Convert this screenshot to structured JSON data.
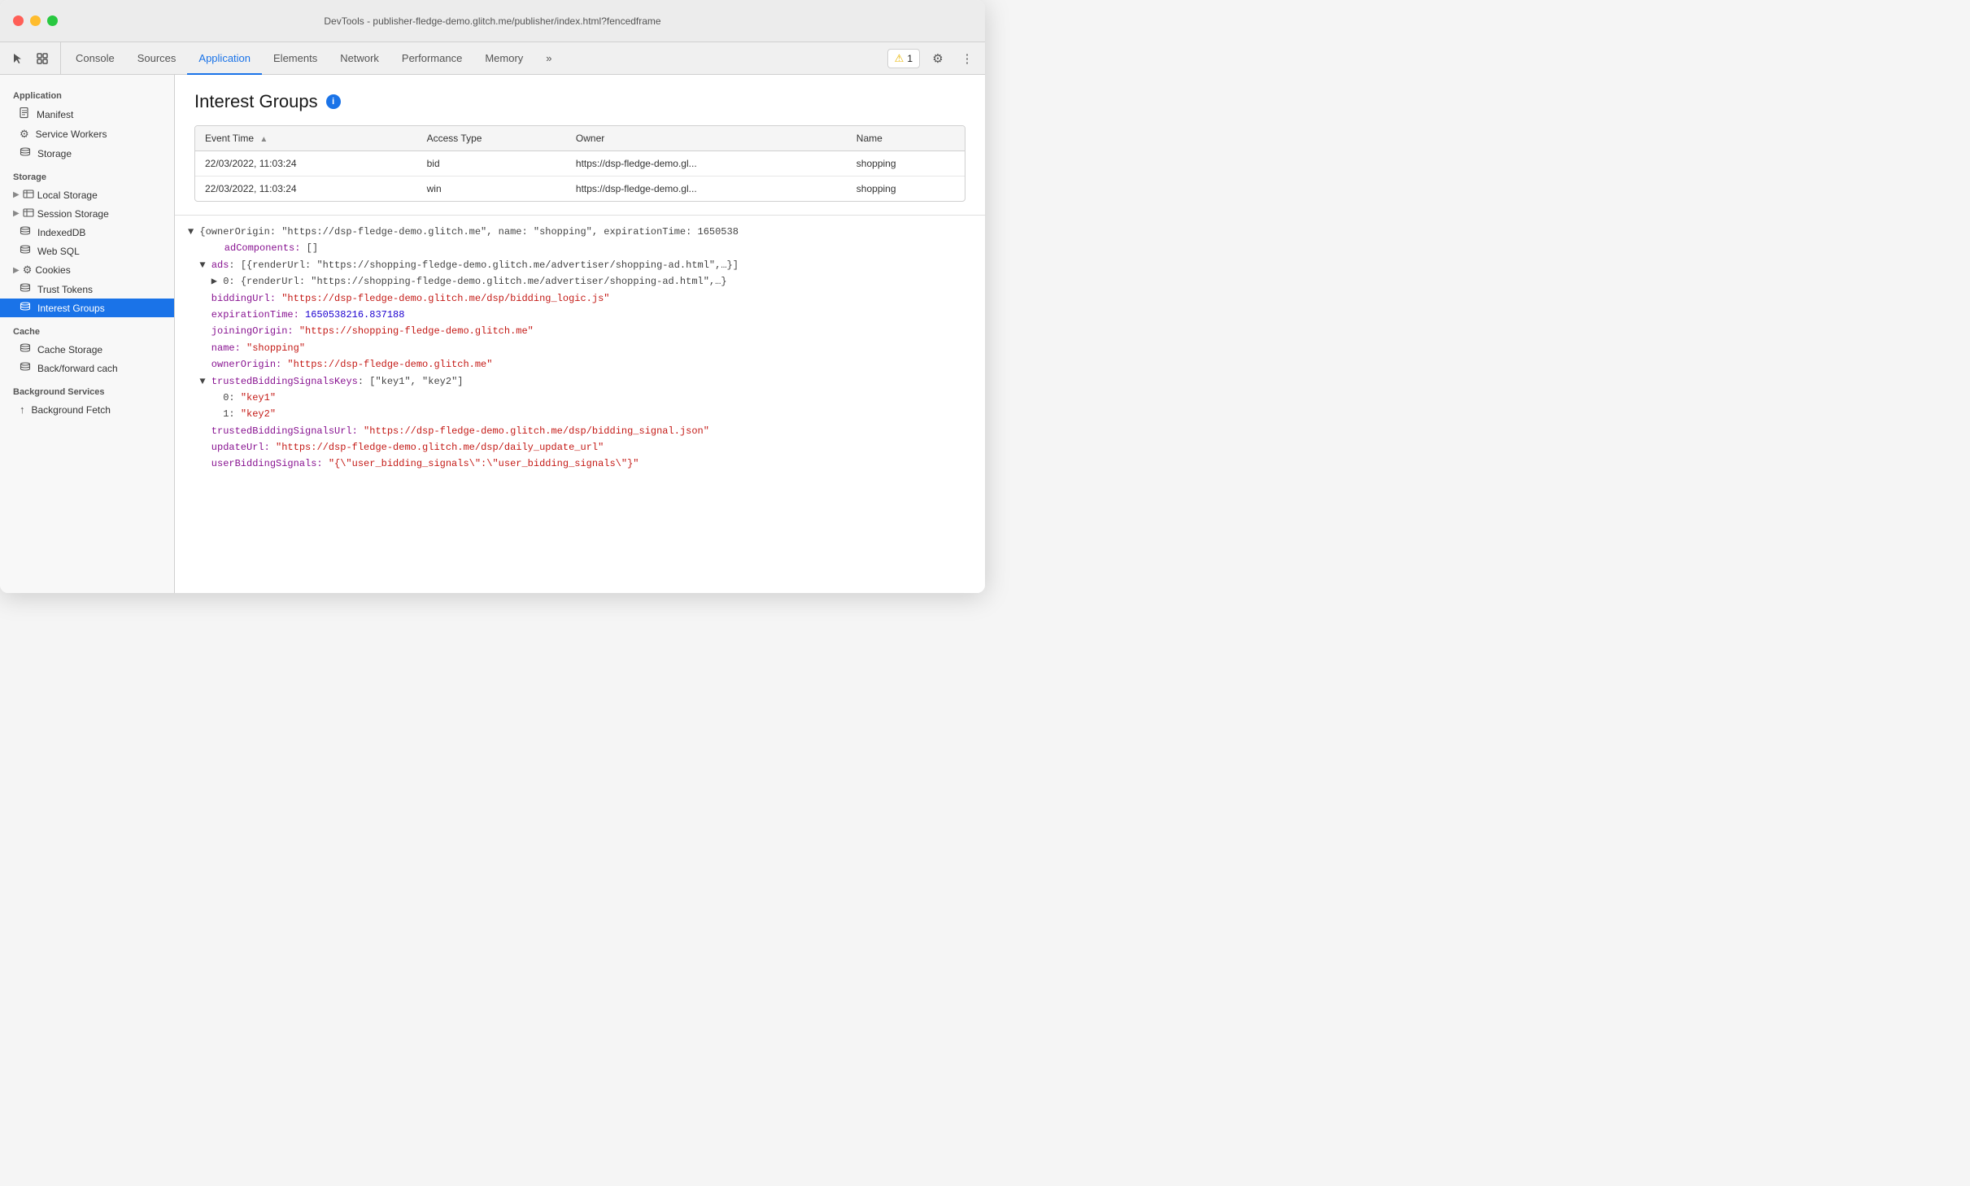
{
  "window": {
    "title": "DevTools - publisher-fledge-demo.glitch.me/publisher/index.html?fencedframe"
  },
  "toolbar": {
    "tabs": [
      {
        "id": "console",
        "label": "Console",
        "active": false
      },
      {
        "id": "sources",
        "label": "Sources",
        "active": false
      },
      {
        "id": "application",
        "label": "Application",
        "active": true
      },
      {
        "id": "elements",
        "label": "Elements",
        "active": false
      },
      {
        "id": "network",
        "label": "Network",
        "active": false
      },
      {
        "id": "performance",
        "label": "Performance",
        "active": false
      },
      {
        "id": "memory",
        "label": "Memory",
        "active": false
      }
    ],
    "more_label": "»",
    "warning_count": "1",
    "settings_icon": "⚙",
    "more_icon": "⋮"
  },
  "sidebar": {
    "sections": [
      {
        "id": "application",
        "label": "Application",
        "items": [
          {
            "id": "manifest",
            "label": "Manifest",
            "icon": "📄",
            "active": false
          },
          {
            "id": "service-workers",
            "label": "Service Workers",
            "icon": "⚙",
            "active": false
          },
          {
            "id": "storage",
            "label": "Storage",
            "icon": "🗄",
            "active": false
          }
        ]
      },
      {
        "id": "storage",
        "label": "Storage",
        "items": [
          {
            "id": "local-storage",
            "label": "Local Storage",
            "icon": "▶",
            "expandable": true,
            "active": false
          },
          {
            "id": "session-storage",
            "label": "Session Storage",
            "icon": "▶",
            "expandable": true,
            "active": false
          },
          {
            "id": "indexeddb",
            "label": "IndexedDB",
            "icon": "🗄",
            "active": false
          },
          {
            "id": "web-sql",
            "label": "Web SQL",
            "icon": "🗄",
            "active": false
          },
          {
            "id": "cookies",
            "label": "Cookies",
            "icon": "▶",
            "expandable": true,
            "active": false
          },
          {
            "id": "trust-tokens",
            "label": "Trust Tokens",
            "icon": "🗄",
            "active": false
          },
          {
            "id": "interest-groups",
            "label": "Interest Groups",
            "icon": "🗄",
            "active": true
          }
        ]
      },
      {
        "id": "cache",
        "label": "Cache",
        "items": [
          {
            "id": "cache-storage",
            "label": "Cache Storage",
            "icon": "🗄",
            "active": false
          },
          {
            "id": "back-forward-cache",
            "label": "Back/forward cach",
            "icon": "🗄",
            "active": false
          }
        ]
      },
      {
        "id": "background-services",
        "label": "Background Services",
        "items": [
          {
            "id": "background-fetch",
            "label": "Background Fetch",
            "icon": "↑",
            "active": false
          }
        ]
      }
    ]
  },
  "interest_groups": {
    "title": "Interest Groups",
    "table": {
      "columns": [
        {
          "id": "event_time",
          "label": "Event Time",
          "sortable": true
        },
        {
          "id": "access_type",
          "label": "Access Type"
        },
        {
          "id": "owner",
          "label": "Owner"
        },
        {
          "id": "name",
          "label": "Name"
        }
      ],
      "rows": [
        {
          "event_time": "22/03/2022, 11:03:24",
          "access_type": "bid",
          "owner": "https://dsp-fledge-demo.gl...",
          "name": "shopping"
        },
        {
          "event_time": "22/03/2022, 11:03:24",
          "access_type": "win",
          "owner": "https://dsp-fledge-demo.gl...",
          "name": "shopping"
        }
      ]
    },
    "detail": {
      "lines": [
        {
          "text": "▼ {ownerOrigin: \"https://dsp-fledge-demo.glitch.me\", name: \"shopping\", expirationTime: 1650538",
          "type": "root"
        },
        {
          "text": "    adComponents: []",
          "type": "indent1"
        },
        {
          "text": "  ▼ ads: [{renderUrl: \"https://shopping-fledge-demo.glitch.me/advertiser/shopping-ad.html\",…}]",
          "type": "indent1-expand"
        },
        {
          "text": "    ▶ 0: {renderUrl: \"https://shopping-fledge-demo.glitch.me/advertiser/shopping-ad.html\",…}",
          "type": "indent2-expand"
        },
        {
          "text": "    biddingUrl: \"https://dsp-fledge-demo.glitch.me/dsp/bidding_logic.js\"",
          "type": "indent1-kv-str",
          "key": "biddingUrl",
          "val": "\"https://dsp-fledge-demo.glitch.me/dsp/bidding_logic.js\""
        },
        {
          "text": "    expirationTime: 1650538216.837188",
          "type": "indent1-kv-num",
          "key": "expirationTime",
          "val": "1650538216.837188"
        },
        {
          "text": "    joiningOrigin: \"https://shopping-fledge-demo.glitch.me\"",
          "type": "indent1-kv-str",
          "key": "joiningOrigin",
          "val": "\"https://shopping-fledge-demo.glitch.me\""
        },
        {
          "text": "    name: \"shopping\"",
          "type": "indent1-kv-str",
          "key": "name",
          "val": "\"shopping\""
        },
        {
          "text": "    ownerOrigin: \"https://dsp-fledge-demo.glitch.me\"",
          "type": "indent1-kv-str",
          "key": "ownerOrigin",
          "val": "\"https://dsp-fledge-demo.glitch.me\""
        },
        {
          "text": "  ▼ trustedBiddingSignalsKeys: [\"key1\", \"key2\"]",
          "type": "indent1-expand"
        },
        {
          "text": "      0: \"key1\"",
          "type": "indent2-kv-str",
          "key": "0",
          "val": "\"key1\""
        },
        {
          "text": "      1: \"key2\"",
          "type": "indent2-kv-str",
          "key": "1",
          "val": "\"key2\""
        },
        {
          "text": "    trustedBiddingSignalsUrl: \"https://dsp-fledge-demo.glitch.me/dsp/bidding_signal.json\"",
          "type": "indent1-kv-str",
          "key": "trustedBiddingSignalsUrl",
          "val": "\"https://dsp-fledge-demo.glitch.me/dsp/bidding_signal.json\""
        },
        {
          "text": "    updateUrl: \"https://dsp-fledge-demo.glitch.me/dsp/daily_update_url\"",
          "type": "indent1-kv-str",
          "key": "updateUrl",
          "val": "\"https://dsp-fledge-demo.glitch.me/dsp/daily_update_url\""
        },
        {
          "text": "    userBiddingSignals: \"{\\\"user_bidding_signals\\\":\\\"user_bidding_signals\\\"}\"",
          "type": "indent1-kv-str",
          "key": "userBiddingSignals",
          "val": "\"{\\\"user_bidding_signals\\\":\\\"user_bidding_signals\\\"}\""
        }
      ]
    }
  }
}
